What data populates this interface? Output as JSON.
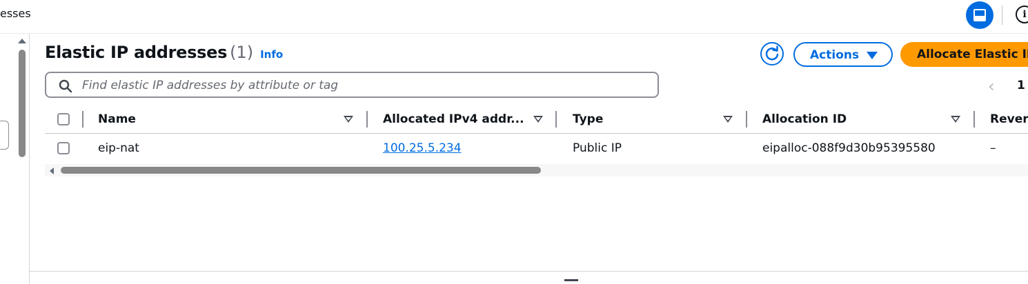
{
  "breadcrumb": {
    "text": "esses"
  },
  "header": {
    "title": "Elastic IP addresses",
    "count": "(1)",
    "info": "Info"
  },
  "toolbar": {
    "actions_label": "Actions",
    "allocate_label": "Allocate Elastic IP"
  },
  "search": {
    "placeholder": "Find elastic IP addresses by attribute or tag",
    "value": ""
  },
  "pagination": {
    "page": "1"
  },
  "table": {
    "columns": [
      "Name",
      "Allocated IPv4 addr...",
      "Type",
      "Allocation ID",
      "Revers"
    ],
    "rows": [
      {
        "name": "eip-nat",
        "ipv4": "100.25.5.234",
        "type": "Public IP",
        "allocation_id": "eipalloc-088f9d30b95395580",
        "reverse_dns": "–"
      }
    ]
  },
  "colors": {
    "accent": "#006ce0",
    "primary_button": "#ff9900",
    "text": "#0f141a"
  },
  "icons": [
    "panel-toggle-icon",
    "info-circle-icon",
    "refresh-icon",
    "search-icon",
    "caret-down-icon",
    "chevron-left-icon",
    "sort-caret-icon"
  ]
}
